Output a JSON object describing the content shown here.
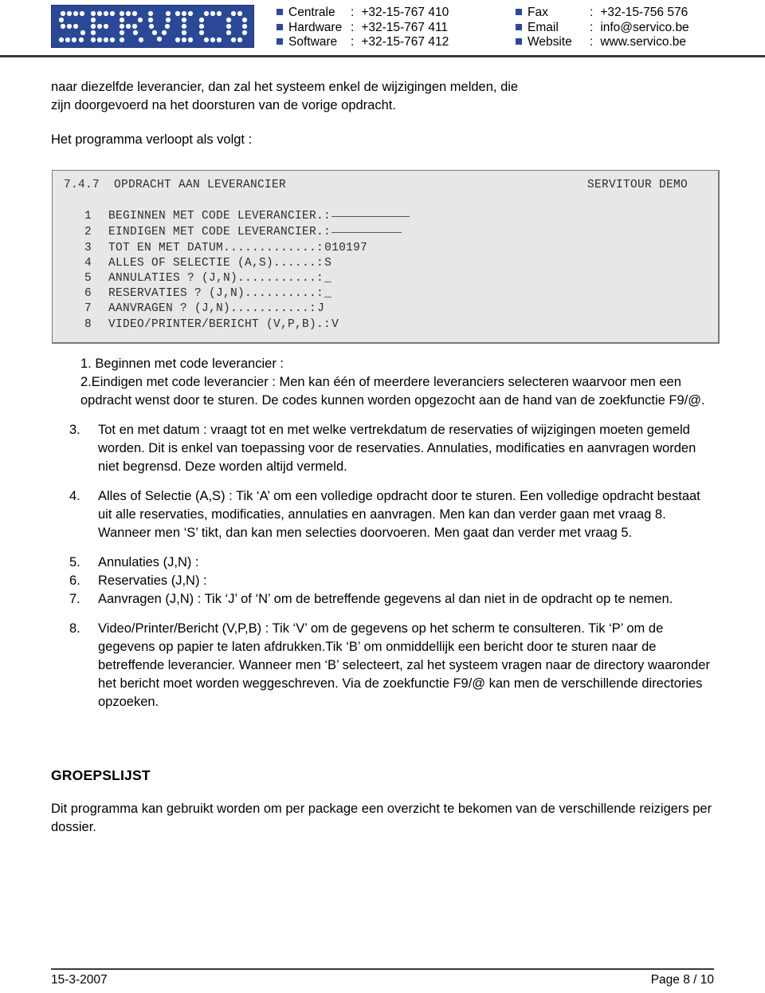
{
  "header": {
    "logo_text": "SERVICO",
    "logo_bg_color": "#2b4896",
    "contacts_left": [
      {
        "label": "Centrale",
        "sep": ":",
        "value": "+32-15-767 410"
      },
      {
        "label": "Hardware",
        "sep": ":",
        "value": "+32-15-767 411"
      },
      {
        "label": "Software",
        "sep": ":",
        "value": "+32-15-767 412"
      }
    ],
    "contacts_right": [
      {
        "label": "Fax",
        "sep": ":",
        "value": "+32-15-756 576"
      },
      {
        "label": "Email",
        "sep": ":",
        "value": "info@servico.be"
      },
      {
        "label": "Website",
        "sep": ":",
        "value": "www.servico.be"
      }
    ]
  },
  "body": {
    "intro_paragraph_line1": "naar diezelfde leverancier, dan zal het systeem enkel de wijzigingen melden, die",
    "intro_paragraph_line2": "zijn doorgevoerd na het doorsturen van de vorige opdracht.",
    "intro_paragraph2": "Het programma verloopt als volgt :"
  },
  "terminal": {
    "title": "7.4.7  OPDRACHT AAN LEVERANCIER",
    "right_label": "SERVITOUR DEMO",
    "lines": [
      {
        "num": "1",
        "label": "BEGINNEN MET CODE LEVERANCIER.",
        "colon": ":",
        "value": "",
        "field": "w10"
      },
      {
        "num": "2",
        "label": "EINDIGEN MET CODE LEVERANCIER.",
        "colon": ":",
        "value": "",
        "field": "w9"
      },
      {
        "num": "3",
        "label": "TOT EN MET DATUM.............",
        "colon": ":",
        "value": "010197",
        "field": ""
      },
      {
        "num": "4",
        "label": "ALLES OF SELECTIE (A,S)......",
        "colon": ":",
        "value": "S",
        "field": ""
      },
      {
        "num": "5",
        "label": "ANNULATIES ? (J,N)...........",
        "colon": ":",
        "value": "_",
        "field": ""
      },
      {
        "num": "6",
        "label": "RESERVATIES ? (J,N)..........",
        "colon": ":",
        "value": "_",
        "field": ""
      },
      {
        "num": "7",
        "label": "AANVRAGEN ? (J,N)...........",
        "colon": ":",
        "value": "J",
        "field": ""
      },
      {
        "num": "8",
        "label": "VIDEO/PRINTER/BERICHT (V,P,B).",
        "colon": ":",
        "value": "V",
        "field": ""
      }
    ]
  },
  "steps": {
    "item1": "1. Beginnen met code leverancier :",
    "item2": "2.Eindigen met code leverancier : Men kan één of meerdere leveranciers selecteren waarvoor men een opdracht wenst door te sturen. De codes kunnen worden opgezocht aan de hand van de zoekfunctie F9/@.",
    "item3_num": "3.",
    "item3_text": "Tot en met datum : vraagt tot en met welke vertrekdatum de reservaties of wijzigingen moeten gemeld worden. Dit is enkel van toepassing voor de reservaties. Annulaties, modificaties en aanvragen worden niet begrensd. Deze worden altijd vermeld.",
    "item4_num": "4.",
    "item4_text": "Alles of Selectie (A,S) : Tik ‘A’ om een volledige opdracht door te sturen. Een volledige opdracht bestaat uit alle reservaties, modificaties, annulaties en aanvragen. Men kan dan verder gaan met vraag 8. Wanneer men ‘S’ tikt, dan kan men selecties doorvoeren. Men gaat dan verder met vraag 5.",
    "item5_num": "5.",
    "item5_text": "Annulaties (J,N) :",
    "item6_num": "6.",
    "item6_text": "Reservaties (J,N) :",
    "item7_num": "7.",
    "item7_text": "Aanvragen (J,N) : Tik ‘J’ of ‘N’ om de betreffende gegevens al dan niet in de opdracht op te nemen.",
    "item8_num": "8.",
    "item8_text": "Video/Printer/Bericht (V,P,B) : Tik ‘V’ om de gegevens op het scherm te consulteren. Tik ‘P’ om de gegevens op papier te laten afdrukken.Tik ‘B’ om onmiddellijk een bericht door te sturen naar de betreffende leverancier. Wanneer men ‘B’ selecteert, zal het systeem vragen naar de directory waaronder het bericht moet worden weggeschreven. Via de zoekfunctie F9/@ kan men de verschillende directories opzoeken."
  },
  "groepslijst": {
    "heading": "GROEPSLIJST",
    "paragraph": "Dit programma kan gebruikt worden om per package een overzicht te bekomen van de verschillende reizigers per dossier."
  },
  "footer": {
    "date": "15-3-2007",
    "page": "Page 8 / 10"
  }
}
